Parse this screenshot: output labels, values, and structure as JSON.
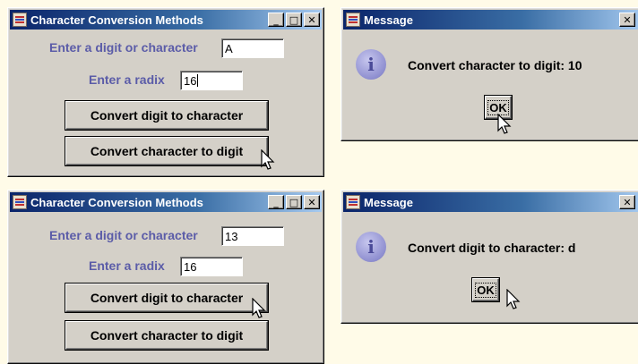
{
  "top_left_window": {
    "title": "Character Conversion Methods",
    "label_char": "Enter a digit or character",
    "char_value": "A",
    "label_radix": "Enter a radix",
    "radix_value": "16",
    "btn_digit_to_char": "Convert digit to character",
    "btn_char_to_digit": "Convert character to digit",
    "icons": [
      "app-icon",
      "minimize-icon",
      "maximize-icon",
      "close-icon"
    ]
  },
  "top_right_dialog": {
    "title": "Message",
    "message": "Convert character to digit: 10",
    "ok_label": "OK",
    "icon": "information-icon"
  },
  "bottom_left_window": {
    "title": "Character Conversion Methods",
    "label_char": "Enter a digit or character",
    "char_value": "13",
    "label_radix": "Enter a radix",
    "radix_value": "16",
    "btn_digit_to_char": "Convert digit to character",
    "btn_char_to_digit": "Convert character to digit"
  },
  "bottom_right_dialog": {
    "title": "Message",
    "message": "Convert digit to character: d",
    "ok_label": "OK",
    "icon": "information-icon"
  },
  "glyphs": {
    "minimize": "_",
    "maximize": "□",
    "close": "✕",
    "info": "i"
  },
  "colors": {
    "titlebar_start": "#0a246a",
    "label": "#5b5ca8",
    "window_bg": "#d4d0c8",
    "page_bg": "#fffbe8"
  }
}
